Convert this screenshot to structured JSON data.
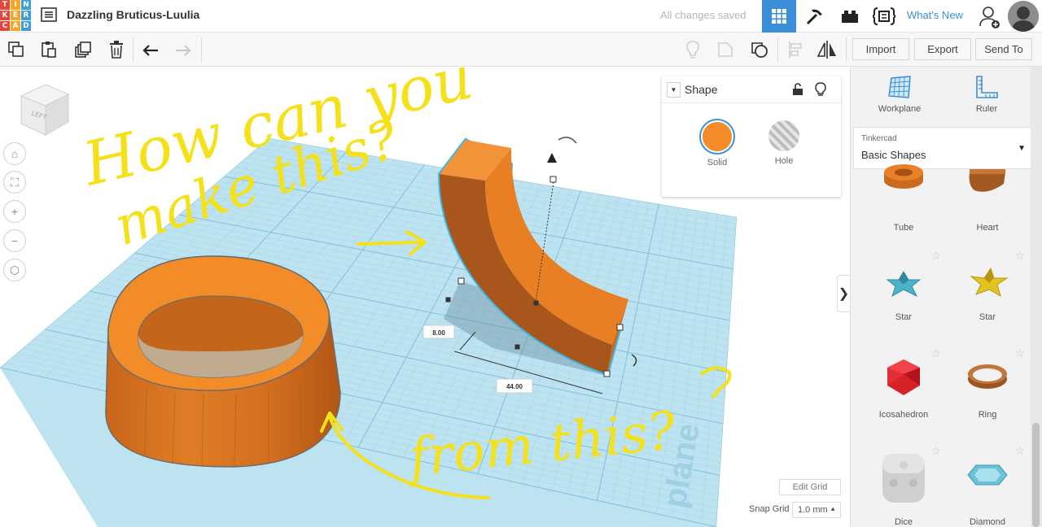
{
  "app": {
    "logo_letters": [
      "T",
      "I",
      "N",
      "K",
      "E",
      "R",
      "C",
      "A",
      "D"
    ],
    "logo_colors": [
      "#e2473b",
      "#f5a623",
      "#3d9fd8",
      "#e2473b",
      "#f5a623",
      "#3d9fd8",
      "#e2473b",
      "#f5a623",
      "#3d9fd8"
    ],
    "design_title": "Dazzling Bruticus-Luulia",
    "save_status": "All changes saved",
    "whats_new": "What's New"
  },
  "toolbar": {
    "import_label": "Import",
    "export_label": "Export",
    "send_to_label": "Send To"
  },
  "viewcube": {
    "face_label": "LEFT"
  },
  "shape_panel": {
    "title": "Shape",
    "solid_label": "Solid",
    "hole_label": "Hole",
    "solid_color": "#f28c28"
  },
  "dimensions": {
    "width_label": "8.00",
    "length_label": "44.00"
  },
  "grid": {
    "edit_label": "Edit Grid",
    "snap_label": "Snap Grid",
    "snap_value": "1.0 mm",
    "plane_label": "plane"
  },
  "right_panel": {
    "workplane_label": "Workplane",
    "ruler_label": "Ruler",
    "library_category": "Tinkercad",
    "library_name": "Basic Shapes",
    "shapes": [
      {
        "name": "Tube"
      },
      {
        "name": "Heart"
      },
      {
        "name": "Star"
      },
      {
        "name": "Star"
      },
      {
        "name": "Icosahedron"
      },
      {
        "name": "Ring"
      },
      {
        "name": "Dice"
      },
      {
        "name": "Diamond"
      }
    ]
  },
  "annotations": {
    "question_line1": "How can you",
    "question_line2": "make this?",
    "question_line3": "from this?",
    "ink_color": "#f5e11a"
  }
}
